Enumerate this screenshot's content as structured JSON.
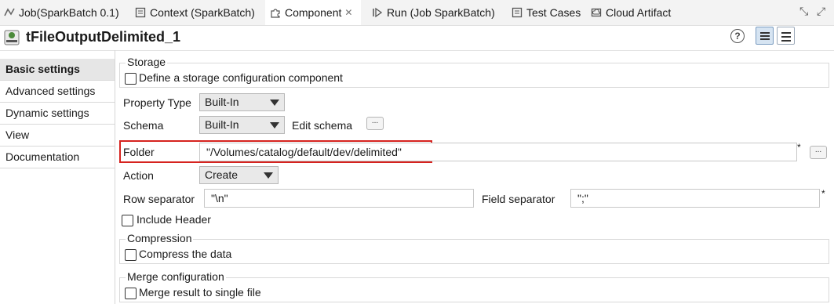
{
  "tabs": [
    {
      "label": "Job(SparkBatch 0.1)",
      "icon": "job-icon"
    },
    {
      "label": "Context (SparkBatch)",
      "icon": "context-icon"
    },
    {
      "label": "Component",
      "icon": "component-icon"
    },
    {
      "label": "Run (Job SparkBatch)",
      "icon": "run-icon"
    },
    {
      "label": "Test Cases",
      "icon": "test-cases-icon"
    },
    {
      "label": "Cloud Artifact",
      "icon": "cloud-artifact-icon"
    }
  ],
  "header": {
    "title": "tFileOutputDelimited_1",
    "help_label": "?"
  },
  "nav": {
    "items": [
      {
        "label": "Basic settings"
      },
      {
        "label": "Advanced settings"
      },
      {
        "label": "Dynamic settings"
      },
      {
        "label": "View"
      },
      {
        "label": "Documentation"
      }
    ]
  },
  "form": {
    "storage": {
      "title": "Storage",
      "checkbox_label": "Define a storage configuration component",
      "checked": false
    },
    "property_type": {
      "label": "Property Type",
      "value": "Built-In"
    },
    "schema": {
      "label": "Schema",
      "value": "Built-In",
      "edit_label": "Edit schema",
      "dots": "..."
    },
    "folder": {
      "label": "Folder",
      "value": "\"/Volumes/catalog/default/dev/delimited\"",
      "required": "*",
      "dots": "..."
    },
    "action": {
      "label": "Action",
      "value": "Create"
    },
    "row_separator": {
      "label": "Row separator",
      "value": "\"\\n\""
    },
    "field_separator": {
      "label": "Field separator",
      "value": "\";\"",
      "required": "*"
    },
    "include_header": {
      "label": "Include Header",
      "checked": false
    },
    "compression": {
      "title": "Compression",
      "checkbox_label": "Compress the data",
      "checked": false
    },
    "merge": {
      "title": "Merge configuration",
      "checkbox_label": "Merge result to single file",
      "checked": false
    }
  },
  "colors": {
    "highlight": "#d6231f",
    "selected_nav": "#e6e6e6"
  }
}
